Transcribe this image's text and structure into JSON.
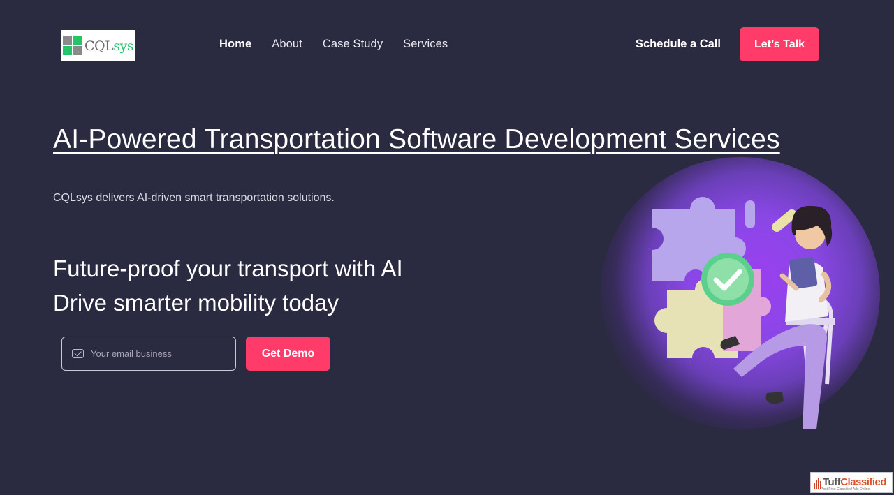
{
  "brand": {
    "logo_text_main": "CQL",
    "logo_text_accent": "sys",
    "accent_color": "#ff3b69",
    "logo_green": "#23c46a"
  },
  "nav": {
    "items": [
      {
        "label": "Home",
        "active": true
      },
      {
        "label": "About",
        "active": false
      },
      {
        "label": "Case Study",
        "active": false
      },
      {
        "label": "Services",
        "active": false
      }
    ]
  },
  "header": {
    "schedule_label": "Schedule a Call",
    "talk_label": "Let’s Talk"
  },
  "hero": {
    "title": "AI-Powered Transportation Software Development Services",
    "subtitle": "CQLsys delivers AI-driven smart transportation solutions.",
    "tagline_line1": "Future-proof your transport with AI",
    "tagline_line2": "Drive smarter mobility today",
    "email_placeholder": "Your email business",
    "demo_label": "Get Demo"
  },
  "illustration": {
    "description_icon": "woman-with-puzzle-illustration"
  },
  "watermark": {
    "text_main": "Tuff",
    "text_accent": "Classified",
    "tagline": "Post Free Classified Ads Online"
  }
}
